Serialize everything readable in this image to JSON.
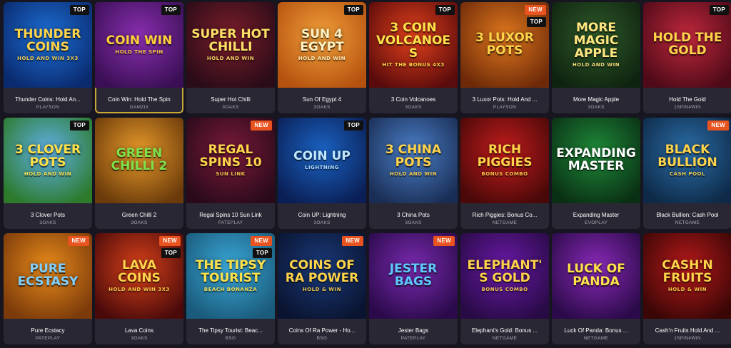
{
  "games": [
    {
      "name": "Thunder Coins: Hold An...",
      "provider": "PLAYSON",
      "art_title": "Thunder Coins",
      "art_sub": "HOLD AND WIN 3x3",
      "badges": [
        "TOP"
      ],
      "bg": [
        "#1d6fd6",
        "#0a2a6e"
      ],
      "fg": "#ffd34a"
    },
    {
      "name": "Coin Win: Hold The Spin",
      "provider": "GAMZIX",
      "art_title": "Coin Win",
      "art_sub": "HOLD THE SPIN",
      "badges": [
        "TOP"
      ],
      "bg": [
        "#8a2fb0",
        "#3a0f55"
      ],
      "fg": "#ffcf3a",
      "selected": true
    },
    {
      "name": "Super Hot Chilli",
      "provider": "3OAKS",
      "art_title": "Super Hot Chilli",
      "art_sub": "HOLD AND WIN",
      "badges": [],
      "bg": [
        "#7a1e2a",
        "#2a0b18"
      ],
      "fg": "#ffe066"
    },
    {
      "name": "Sun Of Egypt 4",
      "provider": "3OAKS",
      "art_title": "Sun 4 Egypt",
      "art_sub": "HOLD AND WIN",
      "badges": [
        "TOP"
      ],
      "bg": [
        "#f2a03a",
        "#b5520f"
      ],
      "fg": "#fff2c2"
    },
    {
      "name": "3 Coin Volcanoes",
      "provider": "3OAKS",
      "art_title": "3 Coin Volcanoes",
      "art_sub": "HIT the BONUS 4x3",
      "badges": [
        "TOP"
      ],
      "bg": [
        "#e3411c",
        "#5a0b0b"
      ],
      "fg": "#ffe14a"
    },
    {
      "name": "3 Luxor Pots: Hold And ...",
      "provider": "PLAYSON",
      "art_title": "3 Luxor Pots",
      "art_sub": "",
      "badges": [
        "NEW",
        "TOP"
      ],
      "bg": [
        "#e0781e",
        "#6e2a08"
      ],
      "fg": "#ffd34a"
    },
    {
      "name": "More Magic Apple",
      "provider": "3OAKS",
      "art_title": "More Magic Apple",
      "art_sub": "HOLD AND WIN",
      "badges": [],
      "bg": [
        "#2f5a2a",
        "#0f2410"
      ],
      "fg": "#ffe680"
    },
    {
      "name": "Hold The Gold",
      "provider": "1SPIN4WIN",
      "art_title": "Hold The Gold",
      "art_sub": "",
      "badges": [
        "TOP"
      ],
      "bg": [
        "#c0283c",
        "#4e0a18"
      ],
      "fg": "#ffd34a"
    },
    {
      "name": "3 Clover Pots",
      "provider": "3OAKS",
      "art_title": "3 Clover Pots",
      "art_sub": "HOLD AND WIN",
      "badges": [
        "TOP"
      ],
      "bg": [
        "#5fb0e8",
        "#2c7a2a"
      ],
      "fg": "#ffe24a"
    },
    {
      "name": "Green Chilli 2",
      "provider": "3OAKS",
      "art_title": "Green Chilli 2",
      "art_sub": "",
      "badges": [],
      "bg": [
        "#e89a2a",
        "#6a3a0a"
      ],
      "fg": "#7ee24a"
    },
    {
      "name": "Regal Spins 10 Sun Link",
      "provider": "PATEPLAY",
      "art_title": "Regal Spins 10",
      "art_sub": "SUN LINK",
      "badges": [
        "NEW"
      ],
      "bg": [
        "#7a1a3a",
        "#2a0a1a"
      ],
      "fg": "#ffd34a"
    },
    {
      "name": "Coin UP: Lightning",
      "provider": "3OAKS",
      "art_title": "Coin Up",
      "art_sub": "LIGHTNING",
      "badges": [
        "TOP"
      ],
      "bg": [
        "#1b63c4",
        "#0a1f55"
      ],
      "fg": "#bfe8ff"
    },
    {
      "name": "3 China Pots",
      "provider": "3OAKS",
      "art_title": "3 China Pots",
      "art_sub": "HOLD AND WIN",
      "badges": [],
      "bg": [
        "#4a7fc8",
        "#1a2e55"
      ],
      "fg": "#ffd34a"
    },
    {
      "name": "Rich Piggies: Bonus Co...",
      "provider": "NETGAME",
      "art_title": "Rich Piggies",
      "art_sub": "BONUS COMBO",
      "badges": [],
      "bg": [
        "#c41d1d",
        "#4a0808"
      ],
      "fg": "#ffd34a"
    },
    {
      "name": "Expanding Master",
      "provider": "EVOPLAY",
      "art_title": "Expanding Master",
      "art_sub": "",
      "badges": [],
      "bg": [
        "#1f8a3a",
        "#0a3014"
      ],
      "fg": "#ffffff"
    },
    {
      "name": "Black Bullion: Cash Pool",
      "provider": "NETGAME",
      "art_title": "Black Bullion",
      "art_sub": "CASH POOL",
      "badges": [
        "NEW"
      ],
      "bg": [
        "#2b6ea8",
        "#0e2a48"
      ],
      "fg": "#ffd34a"
    },
    {
      "name": "Pure Ecstacy",
      "provider": "PATEPLAY",
      "art_title": "Pure Ecstasy",
      "art_sub": "",
      "badges": [
        "NEW"
      ],
      "bg": [
        "#e88a1a",
        "#7a3a0a"
      ],
      "fg": "#7fd0ff"
    },
    {
      "name": "Lava Coins",
      "provider": "3OAKS",
      "art_title": "Lava Coins",
      "art_sub": "HOLD AND WIN 3x3",
      "badges": [
        "NEW",
        "TOP"
      ],
      "bg": [
        "#d9411a",
        "#4a0a0a"
      ],
      "fg": "#ffd34a"
    },
    {
      "name": "The Tipsy Tourist: Beac...",
      "provider": "BSG",
      "art_title": "The Tipsy Tourist",
      "art_sub": "BEACH BONANZA",
      "badges": [
        "NEW",
        "TOP"
      ],
      "bg": [
        "#3aa8d8",
        "#1a5a7a"
      ],
      "fg": "#ffe24a"
    },
    {
      "name": "Coins Of Ra Power - Ho...",
      "provider": "BSG",
      "art_title": "Coins Of Ra Power",
      "art_sub": "HOLD & WIN",
      "badges": [
        "NEW"
      ],
      "bg": [
        "#1a3a7a",
        "#0a1430"
      ],
      "fg": "#ffd34a"
    },
    {
      "name": "Jester Bags",
      "provider": "PATEPLAY",
      "art_title": "Jester Bags",
      "art_sub": "",
      "badges": [
        "NEW"
      ],
      "bg": [
        "#7a2ab0",
        "#2a0a4a"
      ],
      "fg": "#5fc8ff"
    },
    {
      "name": "Elephant's Gold: Bonus ...",
      "provider": "NETGAME",
      "art_title": "Elephant's Gold",
      "art_sub": "BONUS COMBO",
      "badges": [],
      "bg": [
        "#6a1aa8",
        "#280a45"
      ],
      "fg": "#ffd34a"
    },
    {
      "name": "Luck Of Panda: Bonus ...",
      "provider": "NETGAME",
      "art_title": "Luck Of Panda",
      "art_sub": "",
      "badges": [],
      "bg": [
        "#8a2ab8",
        "#2a0a48"
      ],
      "fg": "#ffe24a"
    },
    {
      "name": "Cash'n Fruits Hold And ...",
      "provider": "1SPIN4WIN",
      "art_title": "Cash'n Fruits",
      "art_sub": "HOLD & WIN",
      "badges": [],
      "bg": [
        "#b81a1a",
        "#3a0606"
      ],
      "fg": "#ffd34a"
    }
  ]
}
